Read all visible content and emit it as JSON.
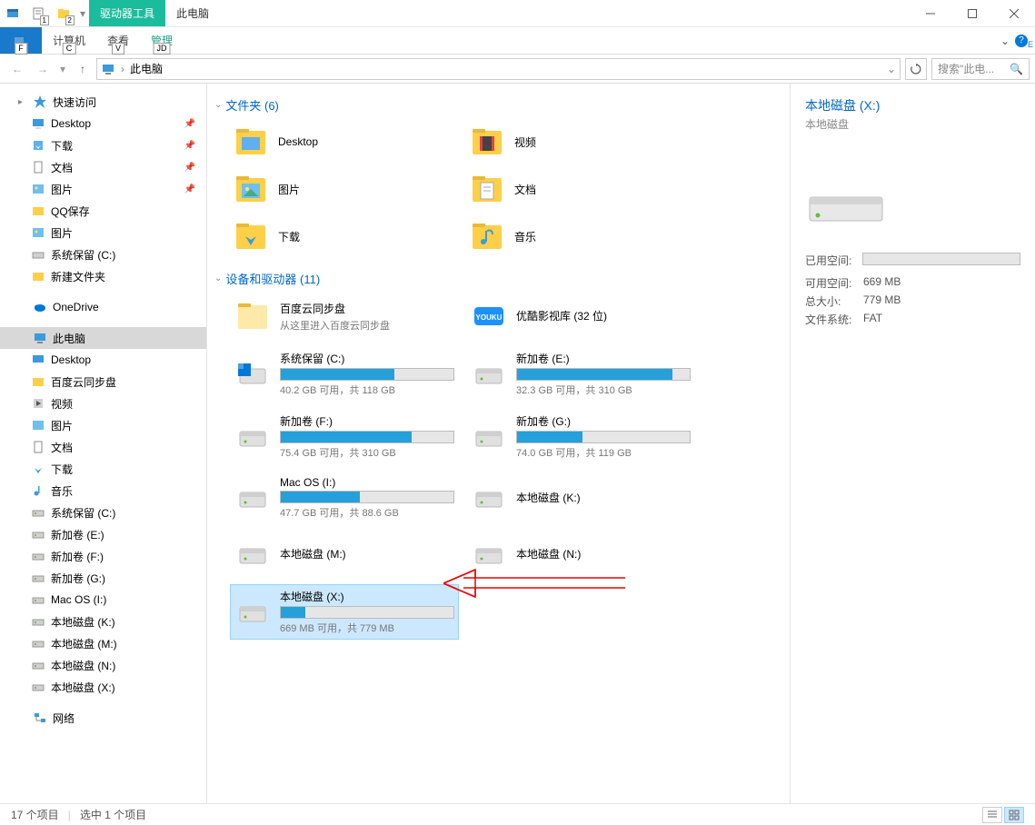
{
  "titlebar": {
    "contextual_tab": "驱动器工具",
    "title": "此电脑",
    "qat_badge1": "1",
    "qat_badge2": "2"
  },
  "ribbon": {
    "file_tab": "F",
    "tabs": [
      "计算机",
      "查看",
      "管理"
    ],
    "key_tips": [
      "C",
      "V",
      "JD"
    ]
  },
  "addressbar": {
    "location": "此电脑",
    "search_placeholder": "搜索\"此电..."
  },
  "sidebar": {
    "quick_access": {
      "label": "快速访问"
    },
    "quick_items": [
      {
        "label": "Desktop",
        "pinned": true
      },
      {
        "label": "下载",
        "pinned": true
      },
      {
        "label": "文档",
        "pinned": true
      },
      {
        "label": "图片",
        "pinned": true
      },
      {
        "label": "QQ保存"
      },
      {
        "label": "图片"
      },
      {
        "label": "系统保留 (C:)"
      },
      {
        "label": "新建文件夹"
      }
    ],
    "onedrive": {
      "label": "OneDrive"
    },
    "this_pc": {
      "label": "此电脑"
    },
    "pc_items": [
      {
        "label": "Desktop"
      },
      {
        "label": "百度云同步盘"
      },
      {
        "label": "视频"
      },
      {
        "label": "图片"
      },
      {
        "label": "文档"
      },
      {
        "label": "下载"
      },
      {
        "label": "音乐"
      },
      {
        "label": "系统保留 (C:)"
      },
      {
        "label": "新加卷 (E:)"
      },
      {
        "label": "新加卷 (F:)"
      },
      {
        "label": "新加卷 (G:)"
      },
      {
        "label": "Mac OS (I:)"
      },
      {
        "label": "本地磁盘 (K:)"
      },
      {
        "label": "本地磁盘 (M:)"
      },
      {
        "label": "本地磁盘 (N:)"
      },
      {
        "label": "本地磁盘 (X:)"
      }
    ],
    "network": {
      "label": "网络"
    }
  },
  "content": {
    "folders_header": "文件夹 (6)",
    "folders": [
      {
        "label": "Desktop"
      },
      {
        "label": "视频"
      },
      {
        "label": "图片"
      },
      {
        "label": "文档"
      },
      {
        "label": "下载"
      },
      {
        "label": "音乐"
      }
    ],
    "drives_header": "设备和驱动器 (11)",
    "special": [
      {
        "label": "百度云同步盘",
        "sub": "从这里进入百度云同步盘"
      },
      {
        "label": "优酷影视库 (32 位)"
      }
    ],
    "drives": [
      {
        "name": "系统保留 (C:)",
        "text": "40.2 GB 可用，共 118 GB",
        "pct": 66
      },
      {
        "name": "新加卷 (E:)",
        "text": "32.3 GB 可用，共 310 GB",
        "pct": 90
      },
      {
        "name": "新加卷 (F:)",
        "text": "75.4 GB 可用，共 310 GB",
        "pct": 76
      },
      {
        "name": "新加卷 (G:)",
        "text": "74.0 GB 可用，共 119 GB",
        "pct": 38
      },
      {
        "name": "Mac OS (I:)",
        "text": "47.7 GB 可用，共 88.6 GB",
        "pct": 46
      },
      {
        "name": "本地磁盘 (K:)",
        "text": "",
        "pct": -1
      },
      {
        "name": "本地磁盘 (M:)",
        "text": "",
        "pct": -1
      },
      {
        "name": "本地磁盘 (N:)",
        "text": "",
        "pct": -1
      },
      {
        "name": "本地磁盘 (X:)",
        "text": "669 MB 可用，共 779 MB",
        "pct": 14,
        "selected": true
      }
    ]
  },
  "details": {
    "title": "本地磁盘 (X:)",
    "subtitle": "本地磁盘",
    "used_label": "已用空间:",
    "used_pct": 14,
    "free_label": "可用空间:",
    "free_value": "669 MB",
    "total_label": "总大小:",
    "total_value": "779 MB",
    "fs_label": "文件系统:",
    "fs_value": "FAT"
  },
  "statusbar": {
    "items": "17 个项目",
    "selection": "选中 1 个项目"
  }
}
